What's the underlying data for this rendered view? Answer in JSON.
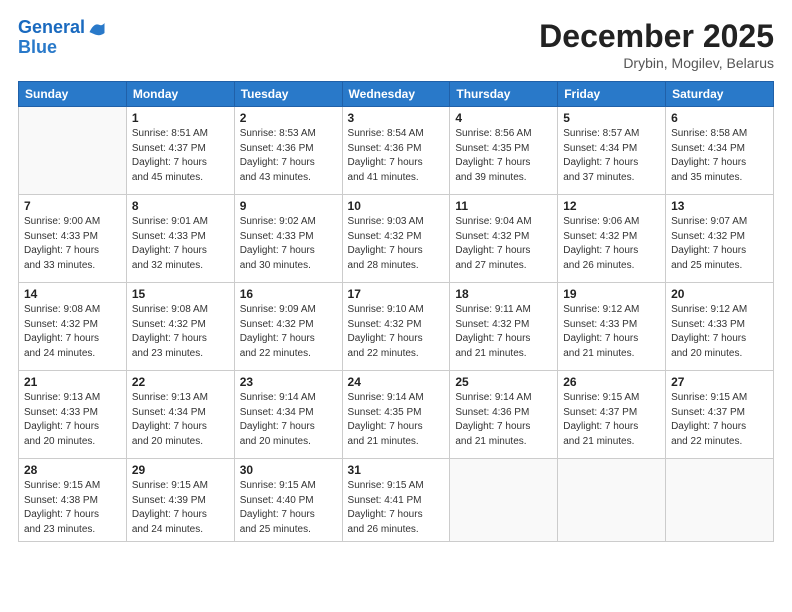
{
  "header": {
    "logo_line1": "General",
    "logo_line2": "Blue",
    "month": "December 2025",
    "location": "Drybin, Mogilev, Belarus"
  },
  "days_of_week": [
    "Sunday",
    "Monday",
    "Tuesday",
    "Wednesday",
    "Thursday",
    "Friday",
    "Saturday"
  ],
  "weeks": [
    [
      {
        "day": "",
        "info": ""
      },
      {
        "day": "1",
        "info": "Sunrise: 8:51 AM\nSunset: 4:37 PM\nDaylight: 7 hours\nand 45 minutes."
      },
      {
        "day": "2",
        "info": "Sunrise: 8:53 AM\nSunset: 4:36 PM\nDaylight: 7 hours\nand 43 minutes."
      },
      {
        "day": "3",
        "info": "Sunrise: 8:54 AM\nSunset: 4:36 PM\nDaylight: 7 hours\nand 41 minutes."
      },
      {
        "day": "4",
        "info": "Sunrise: 8:56 AM\nSunset: 4:35 PM\nDaylight: 7 hours\nand 39 minutes."
      },
      {
        "day": "5",
        "info": "Sunrise: 8:57 AM\nSunset: 4:34 PM\nDaylight: 7 hours\nand 37 minutes."
      },
      {
        "day": "6",
        "info": "Sunrise: 8:58 AM\nSunset: 4:34 PM\nDaylight: 7 hours\nand 35 minutes."
      }
    ],
    [
      {
        "day": "7",
        "info": "Sunrise: 9:00 AM\nSunset: 4:33 PM\nDaylight: 7 hours\nand 33 minutes."
      },
      {
        "day": "8",
        "info": "Sunrise: 9:01 AM\nSunset: 4:33 PM\nDaylight: 7 hours\nand 32 minutes."
      },
      {
        "day": "9",
        "info": "Sunrise: 9:02 AM\nSunset: 4:33 PM\nDaylight: 7 hours\nand 30 minutes."
      },
      {
        "day": "10",
        "info": "Sunrise: 9:03 AM\nSunset: 4:32 PM\nDaylight: 7 hours\nand 28 minutes."
      },
      {
        "day": "11",
        "info": "Sunrise: 9:04 AM\nSunset: 4:32 PM\nDaylight: 7 hours\nand 27 minutes."
      },
      {
        "day": "12",
        "info": "Sunrise: 9:06 AM\nSunset: 4:32 PM\nDaylight: 7 hours\nand 26 minutes."
      },
      {
        "day": "13",
        "info": "Sunrise: 9:07 AM\nSunset: 4:32 PM\nDaylight: 7 hours\nand 25 minutes."
      }
    ],
    [
      {
        "day": "14",
        "info": "Sunrise: 9:08 AM\nSunset: 4:32 PM\nDaylight: 7 hours\nand 24 minutes."
      },
      {
        "day": "15",
        "info": "Sunrise: 9:08 AM\nSunset: 4:32 PM\nDaylight: 7 hours\nand 23 minutes."
      },
      {
        "day": "16",
        "info": "Sunrise: 9:09 AM\nSunset: 4:32 PM\nDaylight: 7 hours\nand 22 minutes."
      },
      {
        "day": "17",
        "info": "Sunrise: 9:10 AM\nSunset: 4:32 PM\nDaylight: 7 hours\nand 22 minutes."
      },
      {
        "day": "18",
        "info": "Sunrise: 9:11 AM\nSunset: 4:32 PM\nDaylight: 7 hours\nand 21 minutes."
      },
      {
        "day": "19",
        "info": "Sunrise: 9:12 AM\nSunset: 4:33 PM\nDaylight: 7 hours\nand 21 minutes."
      },
      {
        "day": "20",
        "info": "Sunrise: 9:12 AM\nSunset: 4:33 PM\nDaylight: 7 hours\nand 20 minutes."
      }
    ],
    [
      {
        "day": "21",
        "info": "Sunrise: 9:13 AM\nSunset: 4:33 PM\nDaylight: 7 hours\nand 20 minutes."
      },
      {
        "day": "22",
        "info": "Sunrise: 9:13 AM\nSunset: 4:34 PM\nDaylight: 7 hours\nand 20 minutes."
      },
      {
        "day": "23",
        "info": "Sunrise: 9:14 AM\nSunset: 4:34 PM\nDaylight: 7 hours\nand 20 minutes."
      },
      {
        "day": "24",
        "info": "Sunrise: 9:14 AM\nSunset: 4:35 PM\nDaylight: 7 hours\nand 21 minutes."
      },
      {
        "day": "25",
        "info": "Sunrise: 9:14 AM\nSunset: 4:36 PM\nDaylight: 7 hours\nand 21 minutes."
      },
      {
        "day": "26",
        "info": "Sunrise: 9:15 AM\nSunset: 4:37 PM\nDaylight: 7 hours\nand 21 minutes."
      },
      {
        "day": "27",
        "info": "Sunrise: 9:15 AM\nSunset: 4:37 PM\nDaylight: 7 hours\nand 22 minutes."
      }
    ],
    [
      {
        "day": "28",
        "info": "Sunrise: 9:15 AM\nSunset: 4:38 PM\nDaylight: 7 hours\nand 23 minutes."
      },
      {
        "day": "29",
        "info": "Sunrise: 9:15 AM\nSunset: 4:39 PM\nDaylight: 7 hours\nand 24 minutes."
      },
      {
        "day": "30",
        "info": "Sunrise: 9:15 AM\nSunset: 4:40 PM\nDaylight: 7 hours\nand 25 minutes."
      },
      {
        "day": "31",
        "info": "Sunrise: 9:15 AM\nSunset: 4:41 PM\nDaylight: 7 hours\nand 26 minutes."
      },
      {
        "day": "",
        "info": ""
      },
      {
        "day": "",
        "info": ""
      },
      {
        "day": "",
        "info": ""
      }
    ]
  ]
}
